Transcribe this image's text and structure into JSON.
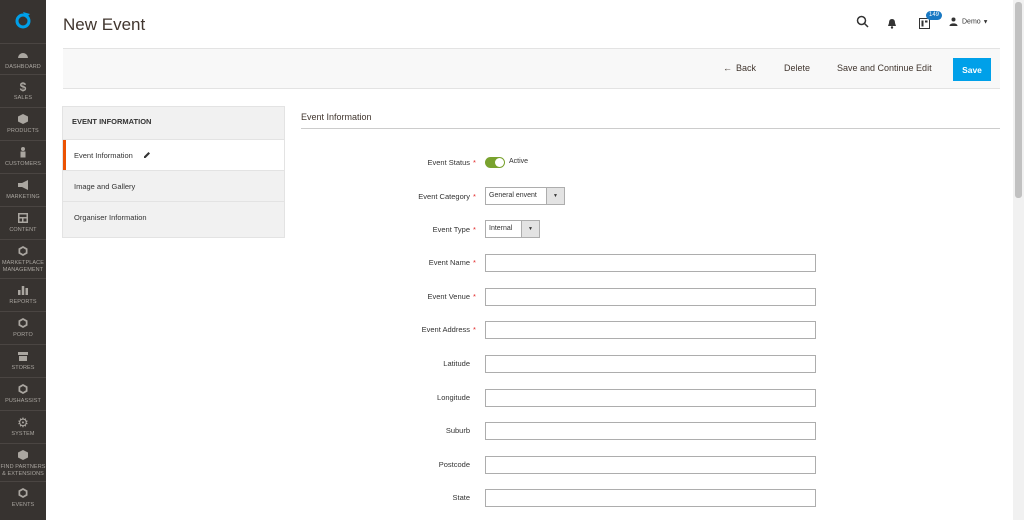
{
  "page": {
    "title": "New Event"
  },
  "sidebar": {
    "items": [
      {
        "label": "DASHBOARD",
        "icon": "dashboard-icon"
      },
      {
        "label": "SALES",
        "icon": "dollar-icon"
      },
      {
        "label": "PRODUCTS",
        "icon": "cube-icon"
      },
      {
        "label": "CUSTOMERS",
        "icon": "person-icon"
      },
      {
        "label": "MARKETING",
        "icon": "megaphone-icon"
      },
      {
        "label": "CONTENT",
        "icon": "layout-icon"
      },
      {
        "label": "MARKETPLACE MANAGEMENT",
        "icon": "hexagon-icon"
      },
      {
        "label": "REPORTS",
        "icon": "bar-chart-icon"
      },
      {
        "label": "PORTO",
        "icon": "hexagon-icon"
      },
      {
        "label": "STORES",
        "icon": "store-icon"
      },
      {
        "label": "PUSHASSIST",
        "icon": "hexagon-icon"
      },
      {
        "label": "SYSTEM",
        "icon": "gear-icon"
      },
      {
        "label": "FIND PARTNERS & EXTENSIONS",
        "icon": "box-icon"
      },
      {
        "label": "EVENTS",
        "icon": "hexagon-icon"
      }
    ]
  },
  "header": {
    "notification_count": "149",
    "user": "Demo"
  },
  "actions": {
    "back": "Back",
    "delete": "Delete",
    "save_continue": "Save and Continue Edit",
    "save": "Save"
  },
  "left_panel": {
    "title": "EVENT INFORMATION",
    "items": [
      "Event Information",
      "Image and Gallery",
      "Organiser Information"
    ]
  },
  "form": {
    "section_title": "Event Information",
    "status": {
      "label": "Event Status",
      "value": "Active"
    },
    "category": {
      "label": "Event Category",
      "value": "General envent"
    },
    "type": {
      "label": "Event Type",
      "value": "Internal"
    },
    "fields": [
      {
        "label": "Event Name",
        "required": "*"
      },
      {
        "label": "Event Venue",
        "required": "*"
      },
      {
        "label": "Event Address",
        "required": "*"
      },
      {
        "label": "Latitude",
        "required": ""
      },
      {
        "label": "Longitude",
        "required": ""
      },
      {
        "label": "Suburb",
        "required": ""
      },
      {
        "label": "Postcode",
        "required": ""
      },
      {
        "label": "State",
        "required": ""
      }
    ]
  },
  "colors": {
    "sidebar": "#373330",
    "accent": "#eb5202",
    "primary_button": "#00a0e9",
    "toggle_on": "#79a22e",
    "required": "#e22626"
  }
}
